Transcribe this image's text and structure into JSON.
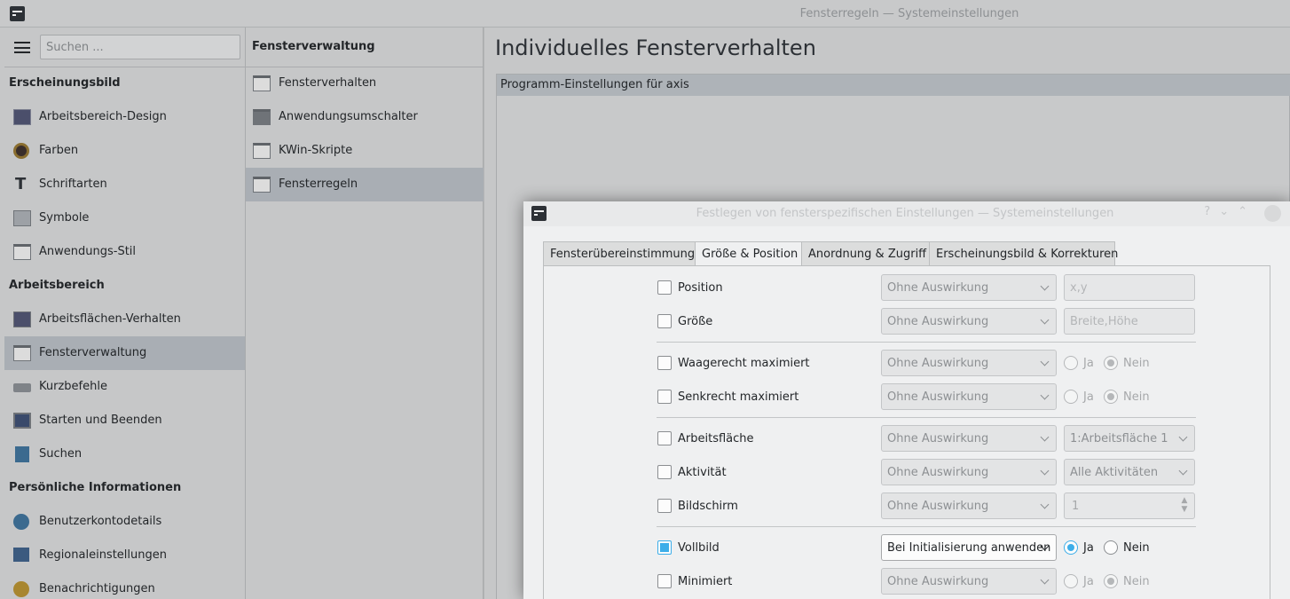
{
  "window": {
    "title": "Fensterregeln — Systemeinstellungen"
  },
  "sidebar": {
    "search_placeholder": "Suchen ...",
    "categories": [
      {
        "title": "Erscheinungsbild",
        "items": [
          {
            "label": "Arbeitsbereich-Design",
            "icon": "workspace-theme-icon"
          },
          {
            "label": "Farben",
            "icon": "colors-icon"
          },
          {
            "label": "Schriftarten",
            "icon": "fonts-icon"
          },
          {
            "label": "Symbole",
            "icon": "icons-icon"
          },
          {
            "label": "Anwendungs-Stil",
            "icon": "application-style-icon"
          }
        ]
      },
      {
        "title": "Arbeitsbereich",
        "items": [
          {
            "label": "Arbeitsflächen-Verhalten",
            "icon": "desktop-behavior-icon"
          },
          {
            "label": "Fensterverwaltung",
            "icon": "window-management-icon",
            "selected": true
          },
          {
            "label": "Kurzbefehle",
            "icon": "keyboard-icon"
          },
          {
            "label": "Starten und Beenden",
            "icon": "startup-icon"
          },
          {
            "label": "Suchen",
            "icon": "search-icon"
          }
        ]
      },
      {
        "title": "Persönliche Informationen",
        "items": [
          {
            "label": "Benutzerkontodetails",
            "icon": "user-icon"
          },
          {
            "label": "Regionaleinstellungen",
            "icon": "region-icon"
          },
          {
            "label": "Benachrichtigungen",
            "icon": "notifications-icon"
          }
        ]
      }
    ]
  },
  "subpanel": {
    "title": "Fensterverwaltung",
    "items": [
      {
        "label": "Fensterverhalten"
      },
      {
        "label": "Anwendungsumschalter"
      },
      {
        "label": "KWin-Skripte"
      },
      {
        "label": "Fensterregeln",
        "selected": true
      }
    ]
  },
  "content": {
    "title": "Individuelles Fensterverhalten",
    "rules_header": "Programm-Einstellungen für axis"
  },
  "dialog": {
    "title": "Festlegen von fensterspezifischen Einstellungen — Systemeinstellungen",
    "tabs": [
      "Fensterübereinstimmung",
      "Größe & Position",
      "Anordnung & Zugriff",
      "Erscheinungsbild & Korrekturen"
    ],
    "active_tab": 1,
    "radio_yes": "Ja",
    "radio_no": "Nein",
    "rows": [
      {
        "label": "Position",
        "checked": false,
        "combo": "Ohne Auswirkung",
        "value_placeholder": "x,y"
      },
      {
        "label": "Größe",
        "checked": false,
        "combo": "Ohne Auswirkung",
        "value_placeholder": "Breite,Höhe"
      },
      {
        "label": "Waagerecht maximiert",
        "checked": false,
        "combo": "Ohne Auswirkung",
        "radio": "no"
      },
      {
        "label": "Senkrecht maximiert",
        "checked": false,
        "combo": "Ohne Auswirkung",
        "radio": "no"
      },
      {
        "label": "Arbeitsfläche",
        "checked": false,
        "combo": "Ohne Auswirkung",
        "value": "1:Arbeitsfläche 1"
      },
      {
        "label": "Aktivität",
        "checked": false,
        "combo": "Ohne Auswirkung",
        "value": "Alle Aktivitäten"
      },
      {
        "label": "Bildschirm",
        "checked": false,
        "combo": "Ohne Auswirkung",
        "value": "1"
      },
      {
        "label": "Vollbild",
        "checked": true,
        "combo": "Bei Initialisierung anwenden",
        "radio": "yes"
      },
      {
        "label": "Minimiert",
        "checked": false,
        "combo": "Ohne Auswirkung",
        "radio": "no"
      }
    ]
  },
  "colors": {
    "accent": "#3daee9",
    "selection": "#a9aeb4"
  }
}
